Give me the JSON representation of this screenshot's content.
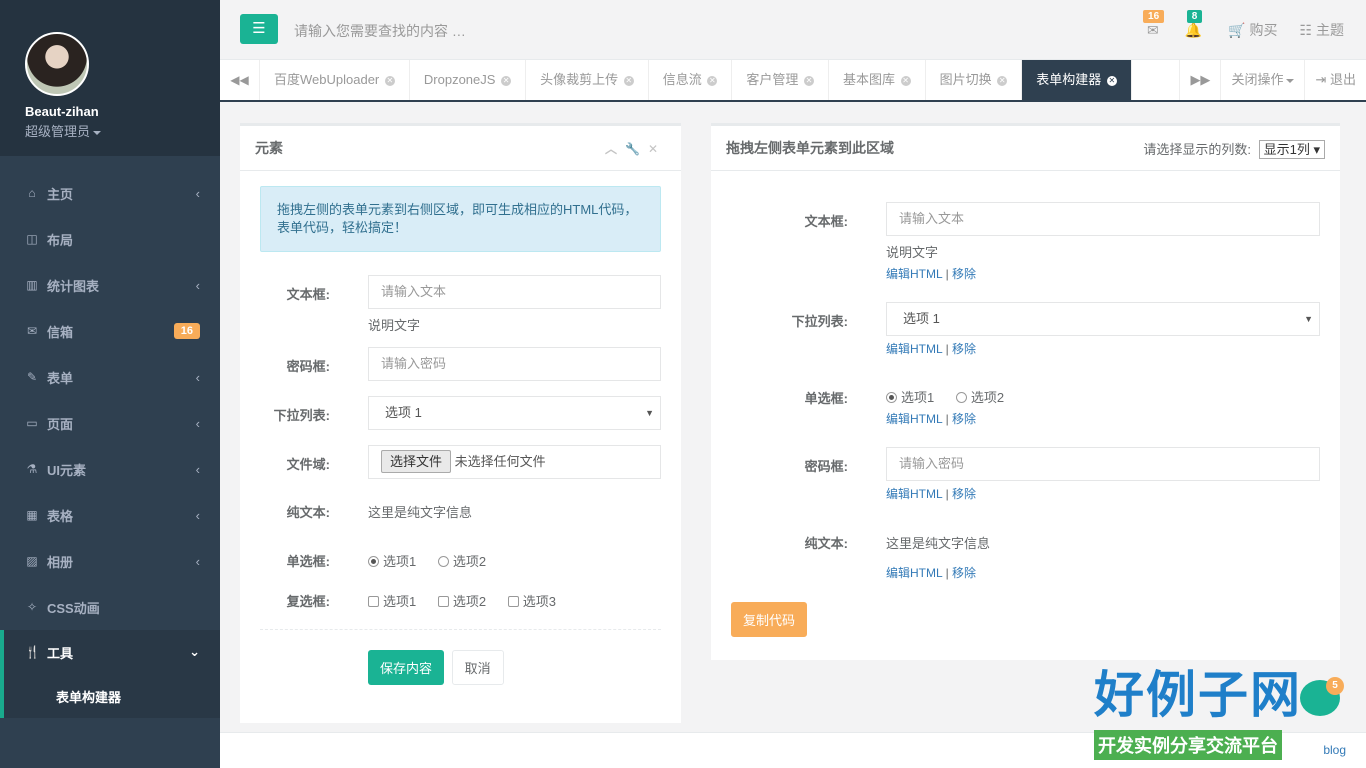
{
  "user": {
    "name": "Beaut-zihan",
    "role": "超级管理员"
  },
  "nav": [
    {
      "icon": "home-icon",
      "glyph": "⌂",
      "label": "主页",
      "arrow": "‹"
    },
    {
      "icon": "layout-icon",
      "glyph": "◫",
      "label": "布局",
      "arrow": ""
    },
    {
      "icon": "chart-icon",
      "glyph": "▥",
      "label": "统计图表",
      "arrow": "‹"
    },
    {
      "icon": "mail-icon",
      "glyph": "✉",
      "label": "信箱",
      "badge": "16"
    },
    {
      "icon": "edit-icon",
      "glyph": "✎",
      "label": "表单",
      "arrow": "‹"
    },
    {
      "icon": "desktop-icon",
      "glyph": "▭",
      "label": "页面",
      "arrow": "‹"
    },
    {
      "icon": "flask-icon",
      "glyph": "⚗",
      "label": "UI元素",
      "arrow": "‹"
    },
    {
      "icon": "table-icon",
      "glyph": "▦",
      "label": "表格",
      "arrow": "‹"
    },
    {
      "icon": "picture-icon",
      "glyph": "▨",
      "label": "相册",
      "arrow": "‹"
    },
    {
      "icon": "magic-icon",
      "glyph": "✧",
      "label": "CSS动画",
      "arrow": ""
    }
  ],
  "nav_active": {
    "label": "工具",
    "arrow": "⌄",
    "sub": "表单构建器"
  },
  "topbar": {
    "search_placeholder": "请输入您需要查找的内容 …",
    "mail_count": "16",
    "bell_count": "8",
    "buy": "购买",
    "theme": "主题"
  },
  "tabs": [
    "百度WebUploader",
    "DropzoneJS",
    "头像裁剪上传",
    "信息流",
    "客户管理",
    "基本图库",
    "图片切换",
    "表单构建器"
  ],
  "tab_actions": {
    "close_ops": "关闭操作",
    "logout": "退出"
  },
  "left_panel": {
    "title": "元素",
    "alert": "拖拽左侧的表单元素到右侧区域，即可生成相应的HTML代码，表单代码，轻松搞定！",
    "text_label": "文本框:",
    "text_placeholder": "请输入文本",
    "text_help": "说明文字",
    "password_label": "密码框:",
    "password_placeholder": "请输入密码",
    "select_label": "下拉列表:",
    "select_value": "选项 1",
    "file_label": "文件域:",
    "file_button": "选择文件",
    "file_none": "未选择任何文件",
    "plain_label": "纯文本:",
    "plain_value": "这里是纯文字信息",
    "radio_label": "单选框:",
    "radio1": "选项1",
    "radio2": "选项2",
    "checkbox_label": "复选框:",
    "check1": "选项1",
    "check2": "选项2",
    "check3": "选项3",
    "save": "保存内容",
    "cancel": "取消"
  },
  "right_panel": {
    "title": "拖拽左侧表单元素到此区域",
    "cols_label": "请选择显示的列数:",
    "cols_value": "显示1列",
    "text_label": "文本框:",
    "text_placeholder": "请输入文本",
    "text_help": "说明文字",
    "select_label": "下拉列表:",
    "select_value": "选项 1",
    "radio_label": "单选框:",
    "radio1": "选项1",
    "radio2": "选项2",
    "password_label": "密码框:",
    "password_placeholder": "请输入密码",
    "plain_label": "纯文本:",
    "plain_value": "这里是纯文字信息",
    "edit_html": "编辑HTML",
    "sep": "|",
    "remove": "移除",
    "copy": "复制代码"
  },
  "footer": {
    "blog": "blog",
    "chat_badge": "5"
  },
  "watermark": {
    "title": "好例子网",
    "subtitle": "开发实例分享交流平台"
  },
  "colors": {
    "primary": "#1ab394",
    "sidebar": "#2f4050",
    "warning": "#f8ac59",
    "link": "#337ab7"
  }
}
